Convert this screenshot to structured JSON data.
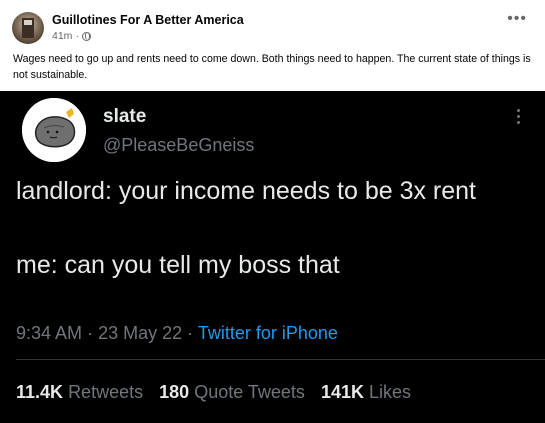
{
  "post": {
    "author": "Guillotines For A Better America",
    "time": "41m",
    "separator": "·",
    "text": "Wages need to go up and rents need to come down. Both things need to happen. The current state of things is not sustainable."
  },
  "tweet": {
    "display_name": "slate",
    "handle": "@PleaseBeGneiss",
    "line1": "landlord: your income needs to be 3x rent",
    "line2": "me: can you tell my boss that",
    "time": "9:34 AM",
    "date": "23 May 22",
    "sep": "·",
    "source": "Twitter for iPhone",
    "stats": [
      {
        "value": "11.4K",
        "label": "Retweets"
      },
      {
        "value": "180",
        "label": "Quote Tweets"
      },
      {
        "value": "141K",
        "label": "Likes"
      }
    ]
  },
  "colors": {
    "tweet_bg": "#000000",
    "link_blue": "#1d9bf0",
    "fb_meta_gray": "#65676b"
  },
  "icons": {
    "post_more": "more-horizontal-icon",
    "privacy": "globe-icon",
    "tweet_more": "more-vertical-icon"
  }
}
